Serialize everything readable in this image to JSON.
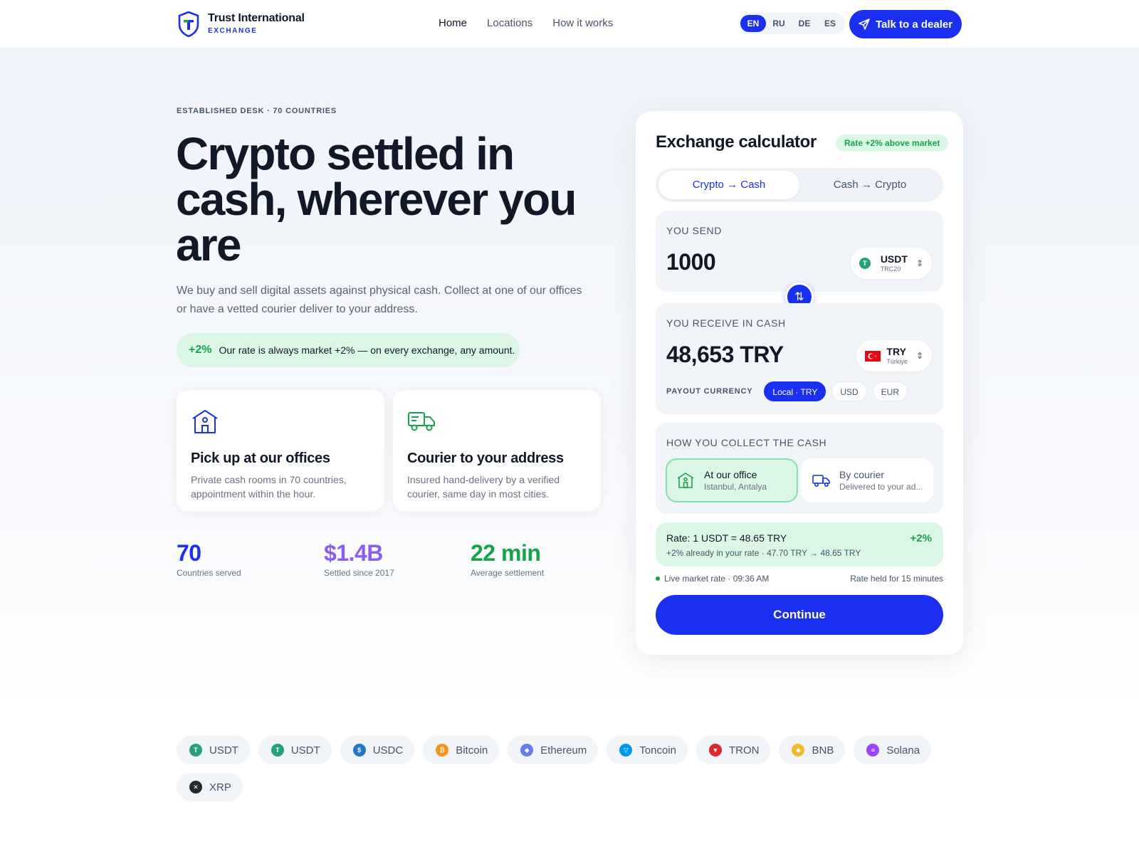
{
  "header": {
    "brand": "Trust International",
    "brand_sub": "EXCHANGE",
    "nav": [
      "Home",
      "Locations",
      "How it works"
    ],
    "languages": [
      "EN",
      "RU",
      "DE",
      "ES"
    ],
    "cta": "Talk to a dealer"
  },
  "hero": {
    "eyebrow": "ESTABLISHED DESK · 70 COUNTRIES",
    "title": "Crypto settled in cash, wherever you are",
    "description": "We buy and sell digital assets against physical cash. Collect at one of our offices or have a vetted courier deliver to your address.",
    "rate_pct": "+2%",
    "rate_text": "Our rate is always market +2% — on every exchange, any amount."
  },
  "features": [
    {
      "title": "Pick up at our offices",
      "text": "Private cash rooms in 70 countries, appointment within the hour."
    },
    {
      "title": "Courier to your address",
      "text": "Insured hand-delivery by a verified courier, same day in most cities."
    }
  ],
  "stats": [
    {
      "value": "70",
      "label": "Countries served",
      "color": "#1a2ff0"
    },
    {
      "value": "$1.4B",
      "label": "Settled since 2017",
      "color": "#8b5cf6"
    },
    {
      "value": "22 min",
      "label": "Average settlement",
      "color": "#16a34a"
    }
  ],
  "calculator": {
    "title": "Exchange calculator",
    "badge": "Rate +2% above market",
    "tabs": [
      "Crypto → Cash",
      "Cash → Crypto"
    ],
    "send_label": "YOU SEND",
    "send_amount": "1000",
    "send_token": "USDT",
    "send_network": "TRC20",
    "receive_label": "YOU RECEIVE IN CASH",
    "receive_amount": "48,653 TRY",
    "receive_currency": "TRY",
    "receive_country": "Türkiye",
    "payout_label": "PAYOUT CURRENCY",
    "payout_options": [
      "Local · TRY",
      "USD",
      "EUR"
    ],
    "collect_label": "HOW YOU COLLECT THE CASH",
    "collect_office_title": "At our office",
    "collect_office_sub": "Istanbul, Antalya",
    "collect_courier_title": "By courier",
    "collect_courier_sub": "Delivered to your ad...",
    "rate_main": "Rate: 1 USDT = 48.65 TRY",
    "rate_sub": "+2% already in your rate · 47.70 TRY → 48.65 TRY",
    "rate_pct": "+2%",
    "live": "Live market rate · 09:36 AM",
    "held": "Rate held for 15 minutes",
    "continue": "Continue"
  },
  "tokens": [
    {
      "name": "USDT",
      "color": "#26a17b",
      "glyph": "T"
    },
    {
      "name": "USDT",
      "color": "#26a17b",
      "glyph": "T"
    },
    {
      "name": "USDC",
      "color": "#2775ca",
      "glyph": "$"
    },
    {
      "name": "Bitcoin",
      "color": "#f7931a",
      "glyph": "₿"
    },
    {
      "name": "Ethereum",
      "color": "#627eea",
      "glyph": "◆"
    },
    {
      "name": "Toncoin",
      "color": "#0098ea",
      "glyph": "▽"
    },
    {
      "name": "TRON",
      "color": "#e0272b",
      "glyph": "▼"
    },
    {
      "name": "BNB",
      "color": "#f3ba2f",
      "glyph": "◆"
    },
    {
      "name": "Solana",
      "color": "#9945ff",
      "glyph": "≡"
    },
    {
      "name": "XRP",
      "color": "#23292f",
      "glyph": "✕"
    }
  ]
}
